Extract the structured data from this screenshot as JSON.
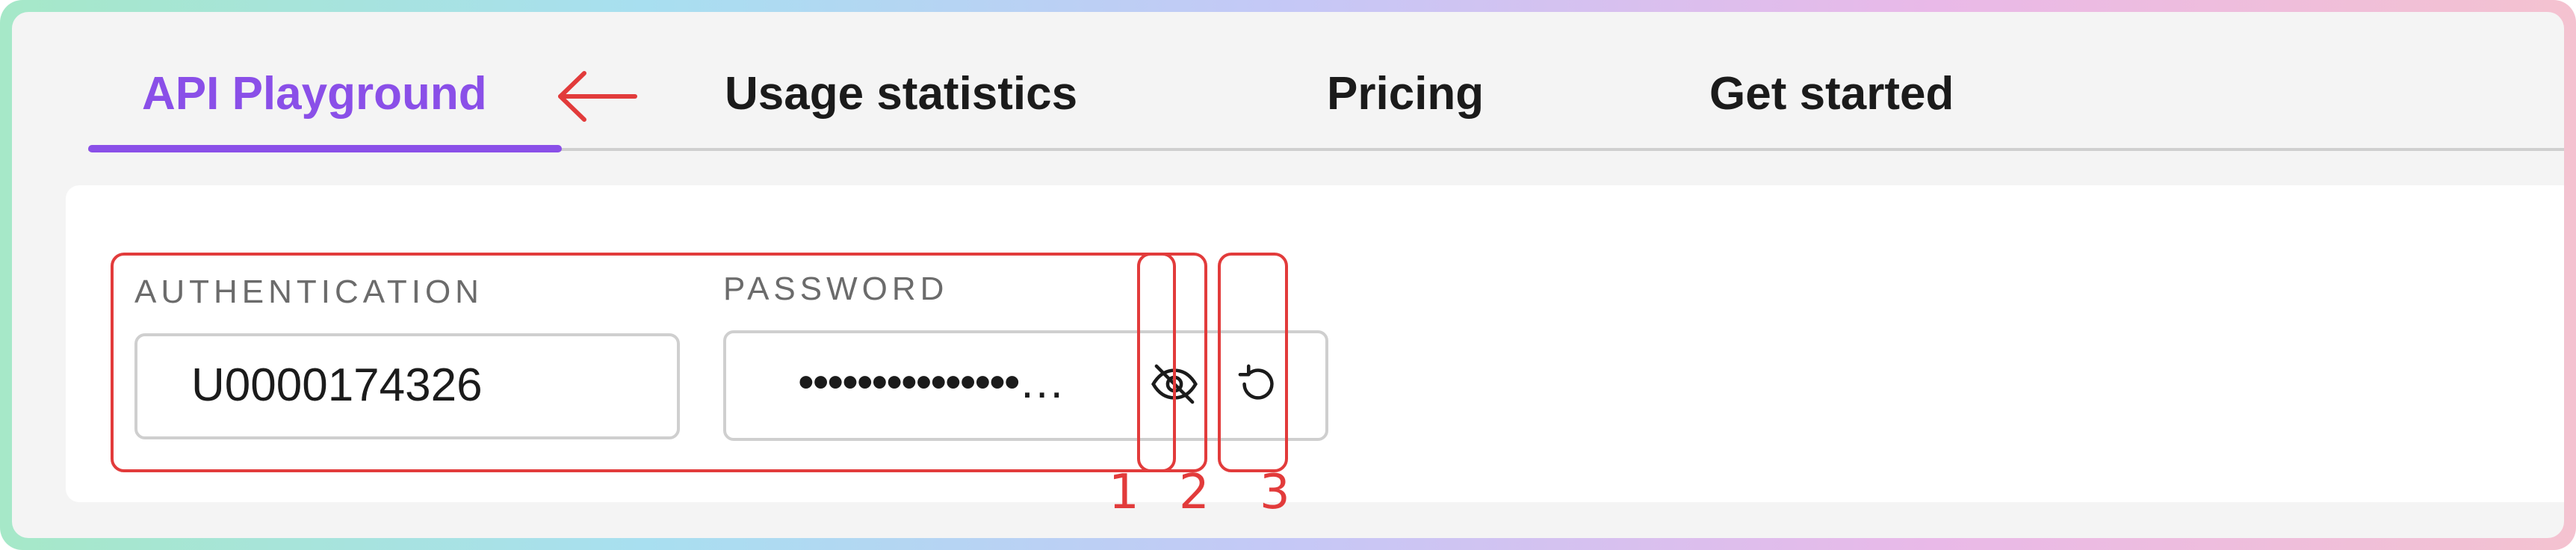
{
  "tabs": [
    {
      "label": "API Playground",
      "active": true
    },
    {
      "label": "Usage statistics",
      "active": false
    },
    {
      "label": "Pricing",
      "active": false
    },
    {
      "label": "Get started",
      "active": false
    }
  ],
  "form": {
    "auth_label": "AUTHENTICATION",
    "auth_value": "U0000174326",
    "password_label": "PASSWORD",
    "password_value": "•••••••••••••••…",
    "toggle_visibility_icon": "eye-slash-icon",
    "refresh_icon": "refresh-icon"
  },
  "annotations": [
    {
      "label": "1"
    },
    {
      "label": "2"
    },
    {
      "label": "3"
    }
  ],
  "colors": {
    "accent": "#8a4fe8",
    "annotation": "#e23b3b",
    "frame_gradient": [
      "#a6e8c8",
      "#a8dff0",
      "#c5c8f6",
      "#e9b9e8",
      "#f4c2d0"
    ]
  }
}
